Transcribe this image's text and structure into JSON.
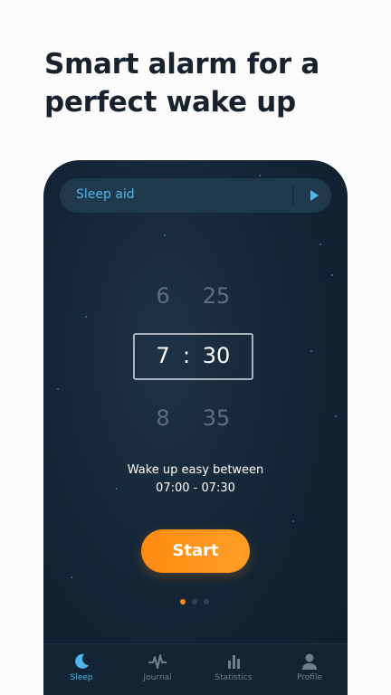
{
  "headline": {
    "line1": "Smart alarm for a",
    "line2": "perfect wake up"
  },
  "sleep_aid": {
    "label": "Sleep aid",
    "play_icon": "play-icon"
  },
  "time_picker": {
    "prev_hour": "6",
    "prev_minute": "25",
    "hour": "7",
    "separator": ":",
    "minute": "30",
    "next_hour": "8",
    "next_minute": "35"
  },
  "wake_window": {
    "line1": "Wake up easy between",
    "line2": "07:00 - 07:30"
  },
  "start_button": {
    "label": "Start"
  },
  "pagination": {
    "count": 3,
    "active_index": 0
  },
  "tabs": [
    {
      "label": "Sleep",
      "icon": "moon-icon",
      "active": true
    },
    {
      "label": "Journal",
      "icon": "pulse-icon",
      "active": false
    },
    {
      "label": "Statistics",
      "icon": "bar-chart-icon",
      "active": false
    },
    {
      "label": "Profile",
      "icon": "user-icon",
      "active": false
    }
  ],
  "colors": {
    "accent_blue": "#4fb6ea",
    "accent_orange": "#ff8a12",
    "background_dark": "#142637",
    "headline_text": "#18222e"
  }
}
